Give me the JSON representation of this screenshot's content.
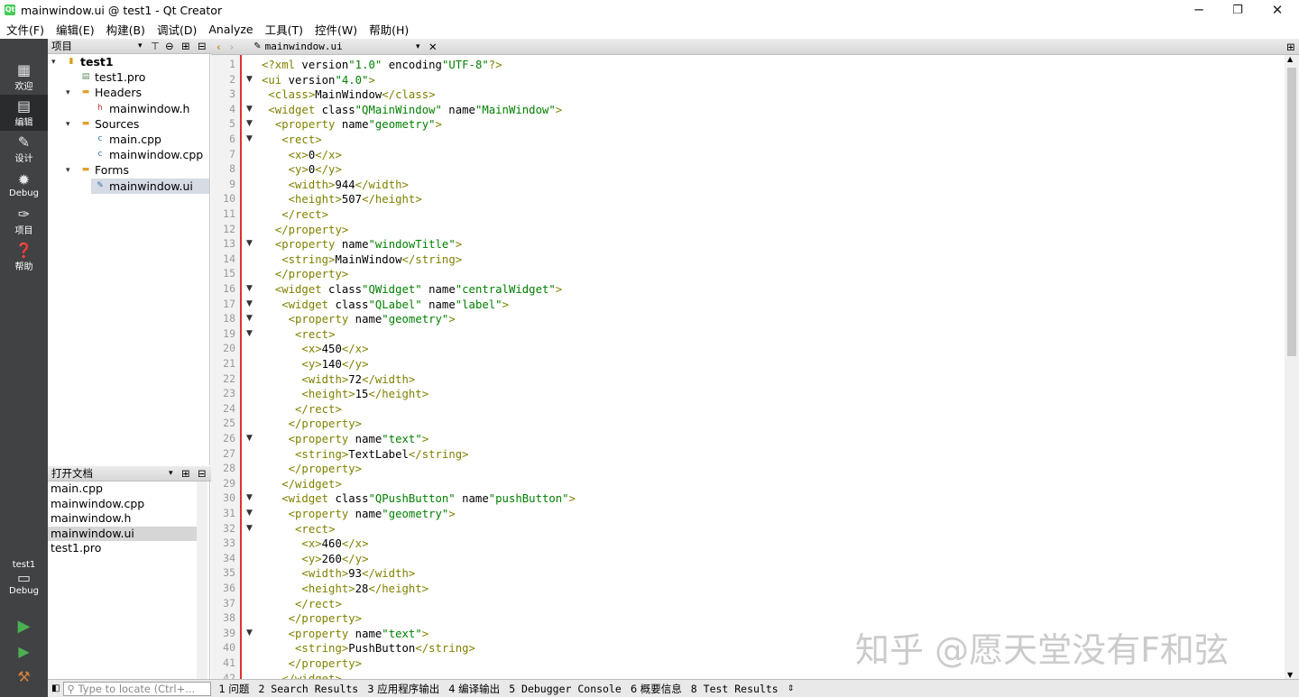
{
  "window": {
    "title": "mainwindow.ui @ test1 - Qt Creator",
    "min": "─",
    "max": "❐",
    "close": "✕"
  },
  "menu": [
    "文件(F)",
    "编辑(E)",
    "构建(B)",
    "调试(D)",
    "Analyze",
    "工具(T)",
    "控件(W)",
    "帮助(H)"
  ],
  "modes": [
    {
      "label": "欢迎",
      "icon": "grid-icon"
    },
    {
      "label": "编辑",
      "icon": "edit-icon"
    },
    {
      "label": "设计",
      "icon": "design-icon"
    },
    {
      "label": "Debug",
      "icon": "bug-icon"
    },
    {
      "label": "项目",
      "icon": "wrench-icon"
    },
    {
      "label": "帮助",
      "icon": "help-icon"
    }
  ],
  "kit": {
    "project": "test1",
    "config": "Debug"
  },
  "projects_panel": {
    "title": "项目"
  },
  "tree": [
    {
      "label": "test1",
      "depth": 0,
      "kind": "project",
      "expanded": true
    },
    {
      "label": "test1.pro",
      "depth": 1,
      "kind": "pro"
    },
    {
      "label": "Headers",
      "depth": 1,
      "kind": "folder",
      "expanded": true
    },
    {
      "label": "mainwindow.h",
      "depth": 2,
      "kind": "h"
    },
    {
      "label": "Sources",
      "depth": 1,
      "kind": "folder",
      "expanded": true
    },
    {
      "label": "main.cpp",
      "depth": 2,
      "kind": "cpp"
    },
    {
      "label": "mainwindow.cpp",
      "depth": 2,
      "kind": "cpp"
    },
    {
      "label": "Forms",
      "depth": 1,
      "kind": "folder",
      "expanded": true
    },
    {
      "label": "mainwindow.ui",
      "depth": 2,
      "kind": "ui",
      "selected": true
    }
  ],
  "open_docs": {
    "title": "打开文档",
    "items": [
      "main.cpp",
      "mainwindow.cpp",
      "mainwindow.h",
      "mainwindow.ui",
      "test1.pro"
    ],
    "selected": 3
  },
  "editor": {
    "tab": "mainwindow.ui"
  },
  "code_lines": [
    "<?xml version=\"1.0\" encoding=\"UTF-8\"?>",
    "<ui version=\"4.0\">",
    " <class>MainWindow</class>",
    " <widget class=\"QMainWindow\" name=\"MainWindow\">",
    "  <property name=\"geometry\">",
    "   <rect>",
    "    <x>0</x>",
    "    <y>0</y>",
    "    <width>944</width>",
    "    <height>507</height>",
    "   </rect>",
    "  </property>",
    "  <property name=\"windowTitle\">",
    "   <string>MainWindow</string>",
    "  </property>",
    "  <widget class=\"QWidget\" name=\"centralWidget\">",
    "   <widget class=\"QLabel\" name=\"label\">",
    "    <property name=\"geometry\">",
    "     <rect>",
    "      <x>450</x>",
    "      <y>140</y>",
    "      <width>72</width>",
    "      <height>15</height>",
    "     </rect>",
    "    </property>",
    "    <property name=\"text\">",
    "     <string>TextLabel</string>",
    "    </property>",
    "   </widget>",
    "   <widget class=\"QPushButton\" name=\"pushButton\">",
    "    <property name=\"geometry\">",
    "     <rect>",
    "      <x>460</x>",
    "      <y>260</y>",
    "      <width>93</width>",
    "      <height>28</height>",
    "     </rect>",
    "    </property>",
    "    <property name=\"text\">",
    "     <string>PushButton</string>",
    "    </property>",
    "   </widget>"
  ],
  "fold_lines": [
    2,
    4,
    5,
    6,
    13,
    16,
    17,
    18,
    19,
    26,
    30,
    31,
    32,
    39
  ],
  "status": {
    "locate_placeholder": "Type to locate (Ctrl+...",
    "panes": [
      "1 问题",
      "2 Search Results",
      "3 应用程序输出",
      "4 编译输出",
      "5 Debugger Console",
      "6 概要信息",
      "8 Test Results"
    ]
  },
  "watermark": "知乎 @愿天堂没有F和弦"
}
